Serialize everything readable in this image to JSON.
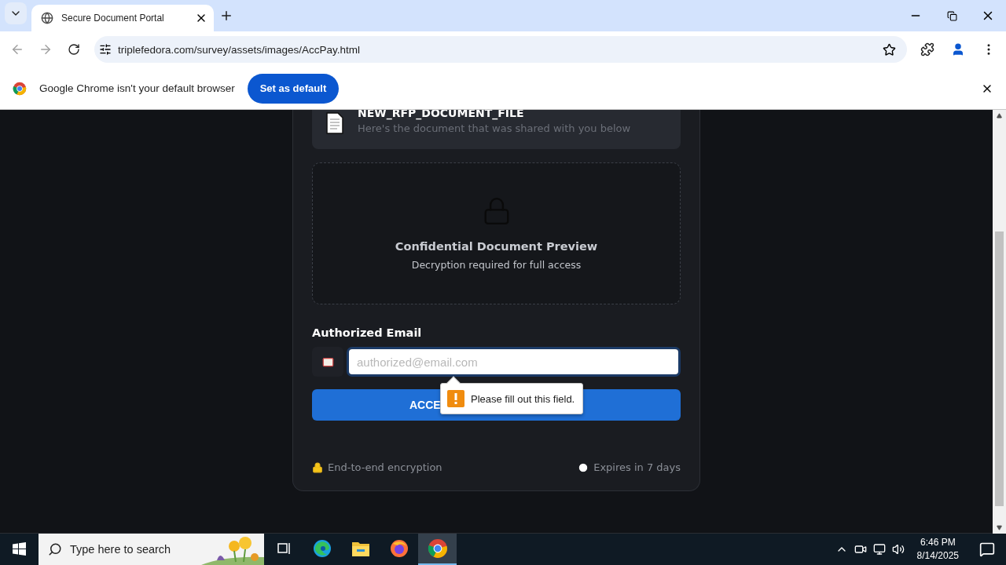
{
  "browser": {
    "tab": {
      "title": "Secure Document Portal"
    },
    "address": "triplefedora.com/survey/assets/images/AccPay.html",
    "infobar": {
      "message": "Google Chrome isn't your default browser",
      "button": "Set as default"
    }
  },
  "document": {
    "name": "NEW_RFP_DOCUMENT_FILE",
    "subtitle": "Here's the document that was shared with you below"
  },
  "preview": {
    "title": "Confidential Document Preview",
    "subtitle": "Decryption required for full access"
  },
  "email": {
    "label": "Authorized Email",
    "placeholder": "authorized@email.com"
  },
  "submit": {
    "label": "ACCE"
  },
  "validation": {
    "message": "Please fill out this field."
  },
  "footer": {
    "encryption": "End-to-end encryption",
    "expiry": "Expires in 7 days"
  },
  "taskbar": {
    "search_placeholder": "Type here to search",
    "apps": [
      {
        "kind": "taskview",
        "selected": false
      },
      {
        "kind": "edge",
        "selected": false
      },
      {
        "kind": "explorer",
        "selected": false
      },
      {
        "kind": "firefox",
        "selected": false
      },
      {
        "kind": "chrome",
        "selected": true
      }
    ],
    "time": "6:46 PM",
    "date": "8/14/2025"
  }
}
